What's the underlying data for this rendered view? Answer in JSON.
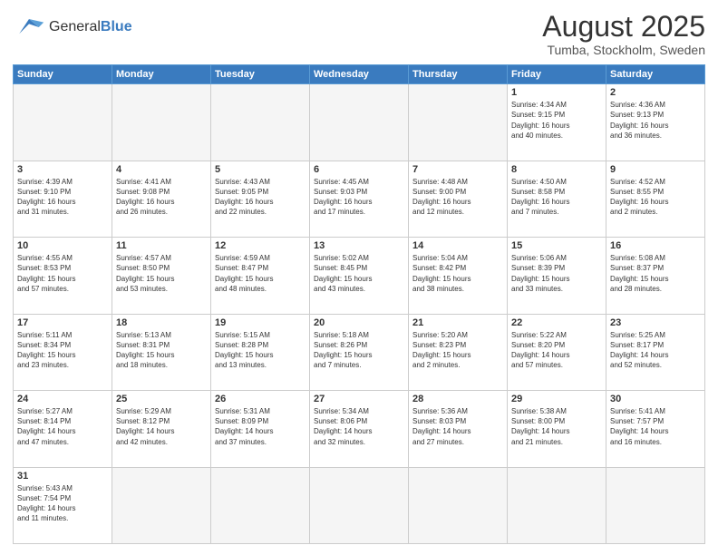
{
  "header": {
    "logo_general": "General",
    "logo_blue": "Blue",
    "month_title": "August 2025",
    "location": "Tumba, Stockholm, Sweden"
  },
  "weekdays": [
    "Sunday",
    "Monday",
    "Tuesday",
    "Wednesday",
    "Thursday",
    "Friday",
    "Saturday"
  ],
  "days": {
    "1": {
      "sunrise": "4:34 AM",
      "sunset": "9:15 PM",
      "daylight": "16 hours and 40 minutes."
    },
    "2": {
      "sunrise": "4:36 AM",
      "sunset": "9:13 PM",
      "daylight": "16 hours and 36 minutes."
    },
    "3": {
      "sunrise": "4:39 AM",
      "sunset": "9:10 PM",
      "daylight": "16 hours and 31 minutes."
    },
    "4": {
      "sunrise": "4:41 AM",
      "sunset": "9:08 PM",
      "daylight": "16 hours and 26 minutes."
    },
    "5": {
      "sunrise": "4:43 AM",
      "sunset": "9:05 PM",
      "daylight": "16 hours and 22 minutes."
    },
    "6": {
      "sunrise": "4:45 AM",
      "sunset": "9:03 PM",
      "daylight": "16 hours and 17 minutes."
    },
    "7": {
      "sunrise": "4:48 AM",
      "sunset": "9:00 PM",
      "daylight": "16 hours and 12 minutes."
    },
    "8": {
      "sunrise": "4:50 AM",
      "sunset": "8:58 PM",
      "daylight": "16 hours and 7 minutes."
    },
    "9": {
      "sunrise": "4:52 AM",
      "sunset": "8:55 PM",
      "daylight": "16 hours and 2 minutes."
    },
    "10": {
      "sunrise": "4:55 AM",
      "sunset": "8:53 PM",
      "daylight": "15 hours and 57 minutes."
    },
    "11": {
      "sunrise": "4:57 AM",
      "sunset": "8:50 PM",
      "daylight": "15 hours and 53 minutes."
    },
    "12": {
      "sunrise": "4:59 AM",
      "sunset": "8:47 PM",
      "daylight": "15 hours and 48 minutes."
    },
    "13": {
      "sunrise": "5:02 AM",
      "sunset": "8:45 PM",
      "daylight": "15 hours and 43 minutes."
    },
    "14": {
      "sunrise": "5:04 AM",
      "sunset": "8:42 PM",
      "daylight": "15 hours and 38 minutes."
    },
    "15": {
      "sunrise": "5:06 AM",
      "sunset": "8:39 PM",
      "daylight": "15 hours and 33 minutes."
    },
    "16": {
      "sunrise": "5:08 AM",
      "sunset": "8:37 PM",
      "daylight": "15 hours and 28 minutes."
    },
    "17": {
      "sunrise": "5:11 AM",
      "sunset": "8:34 PM",
      "daylight": "15 hours and 23 minutes."
    },
    "18": {
      "sunrise": "5:13 AM",
      "sunset": "8:31 PM",
      "daylight": "15 hours and 18 minutes."
    },
    "19": {
      "sunrise": "5:15 AM",
      "sunset": "8:28 PM",
      "daylight": "15 hours and 13 minutes."
    },
    "20": {
      "sunrise": "5:18 AM",
      "sunset": "8:26 PM",
      "daylight": "15 hours and 7 minutes."
    },
    "21": {
      "sunrise": "5:20 AM",
      "sunset": "8:23 PM",
      "daylight": "15 hours and 2 minutes."
    },
    "22": {
      "sunrise": "5:22 AM",
      "sunset": "8:20 PM",
      "daylight": "14 hours and 57 minutes."
    },
    "23": {
      "sunrise": "5:25 AM",
      "sunset": "8:17 PM",
      "daylight": "14 hours and 52 minutes."
    },
    "24": {
      "sunrise": "5:27 AM",
      "sunset": "8:14 PM",
      "daylight": "14 hours and 47 minutes."
    },
    "25": {
      "sunrise": "5:29 AM",
      "sunset": "8:12 PM",
      "daylight": "14 hours and 42 minutes."
    },
    "26": {
      "sunrise": "5:31 AM",
      "sunset": "8:09 PM",
      "daylight": "14 hours and 37 minutes."
    },
    "27": {
      "sunrise": "5:34 AM",
      "sunset": "8:06 PM",
      "daylight": "14 hours and 32 minutes."
    },
    "28": {
      "sunrise": "5:36 AM",
      "sunset": "8:03 PM",
      "daylight": "14 hours and 27 minutes."
    },
    "29": {
      "sunrise": "5:38 AM",
      "sunset": "8:00 PM",
      "daylight": "14 hours and 21 minutes."
    },
    "30": {
      "sunrise": "5:41 AM",
      "sunset": "7:57 PM",
      "daylight": "14 hours and 16 minutes."
    },
    "31": {
      "sunrise": "5:43 AM",
      "sunset": "7:54 PM",
      "daylight": "14 hours and 11 minutes."
    }
  }
}
